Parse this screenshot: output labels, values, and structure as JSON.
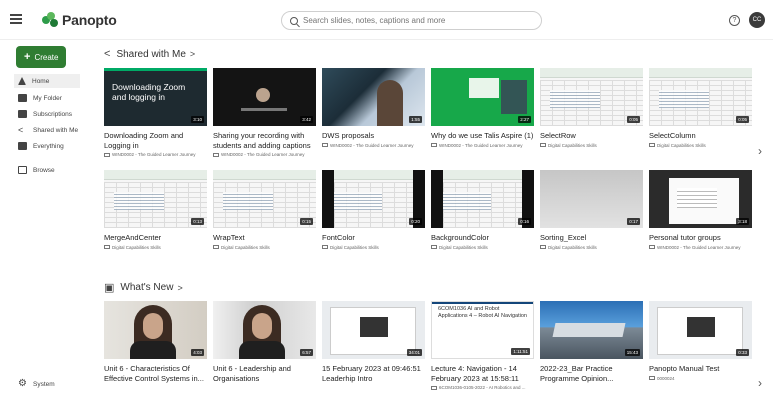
{
  "app": {
    "name": "Panopto",
    "search_placeholder": "Search slides, notes, captions and more",
    "help_icon": "?",
    "avatar_initials": "CC"
  },
  "sidebar": {
    "create_label": "Create",
    "items": [
      {
        "label": "Home",
        "icon": "home-icon",
        "active": true
      },
      {
        "label": "My Folder",
        "icon": "folder-icon"
      },
      {
        "label": "Subscriptions",
        "icon": "subscriptions-icon"
      },
      {
        "label": "Shared with Me",
        "icon": "share-icon"
      },
      {
        "label": "Everything",
        "icon": "everything-icon"
      },
      {
        "label": "Browse",
        "icon": "browse-icon"
      }
    ],
    "system_label": "System"
  },
  "shared": {
    "title": "Shared with Me",
    "row1": [
      {
        "title": "Downloading Zoom and Logging in",
        "folder": "WIND0002 - The Guided Learner Journey",
        "duration": "3:10",
        "thumb_text": "Downloading Zoom and logging in"
      },
      {
        "title": "Sharing your recording with students and adding captions",
        "folder": "WIND0002 - The Guided Learner Journey",
        "duration": "3:42"
      },
      {
        "title": "DWS proposals",
        "folder": "WIND0002 - The Guided Learner Journey",
        "duration": "1:55"
      },
      {
        "title": "Why do we use Talis Aspire (1)",
        "folder": "WIND0002 - The Guided Learner Journey",
        "duration": "2:27"
      },
      {
        "title": "SelectRow",
        "folder": "Digital Capabilities Skills",
        "duration": "0:05"
      },
      {
        "title": "SelectColumn",
        "folder": "Digital Capabilities Skills",
        "duration": "0:05"
      }
    ],
    "row2": [
      {
        "title": "MergeAndCenter",
        "folder": "Digital Capabilities Skills",
        "duration": "0:13"
      },
      {
        "title": "WrapText",
        "folder": "Digital Capabilities Skills",
        "duration": "0:15"
      },
      {
        "title": "FontColor",
        "folder": "Digital Capabilities Skills",
        "duration": "0:20"
      },
      {
        "title": "BackgroundColor",
        "folder": "Digital Capabilities Skills",
        "duration": "0:16"
      },
      {
        "title": "Sorting_Excel",
        "folder": "Digital Capabilities Skills",
        "duration": "0:17"
      },
      {
        "title": "Personal tutor groups",
        "folder": "WIND0002 - The Guided Learner Journey",
        "duration": "3:18"
      }
    ]
  },
  "whats_new": {
    "title": "What's New",
    "items": [
      {
        "title": "Unit 6 - Characteristics Of Effective Control Systems in...",
        "folder": "",
        "duration": "4:03"
      },
      {
        "title": "Unit 6 - Leadership and Organisations",
        "folder": "",
        "duration": "6:57"
      },
      {
        "title": "15 February 2023 at 09:46:51 Leaderhip Intro",
        "folder": "",
        "duration": "34:01"
      },
      {
        "title": "Lecture 4: Navigation - 14 February 2023 at 15:58:11",
        "folder": "6COM1036-0105-2022 - AI Robotics and ...",
        "duration": "1:11:51",
        "thumb_text": "6COM1036 AI and Robot Applications 4 – Robot AI Navigation"
      },
      {
        "title": "2022-23_Bar Practice Programme Opinion...",
        "folder": "",
        "duration": "15:43"
      },
      {
        "title": "Panopto Manual Test",
        "folder": "0000024",
        "duration": "0:33"
      }
    ]
  }
}
